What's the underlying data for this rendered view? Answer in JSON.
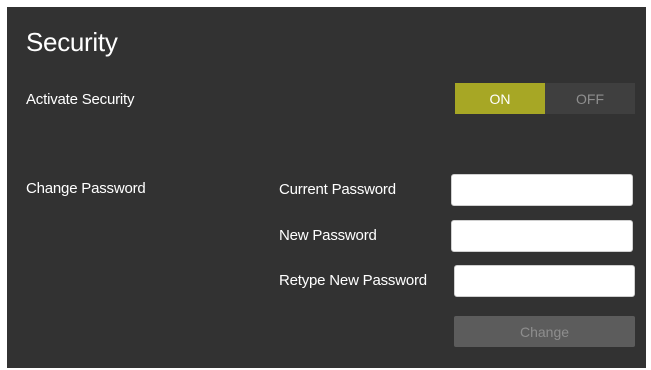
{
  "page": {
    "title": "Security"
  },
  "activate_security": {
    "label": "Activate Security",
    "toggle": {
      "on_label": "ON",
      "off_label": "OFF",
      "selected": "ON",
      "on_color": "#a7a725",
      "off_color": "#3f3f3f"
    }
  },
  "change_password": {
    "section_label": "Change Password",
    "fields": {
      "current": {
        "label": "Current Password",
        "value": "",
        "placeholder": ""
      },
      "new": {
        "label": "New Password",
        "value": "",
        "placeholder": ""
      },
      "retype": {
        "label": "Retype New Password",
        "value": "",
        "placeholder": ""
      }
    },
    "button": {
      "label": "Change",
      "enabled": false
    }
  },
  "colors": {
    "panel_background": "#323232",
    "text": "#ffffff",
    "accent": "#a7a725"
  }
}
